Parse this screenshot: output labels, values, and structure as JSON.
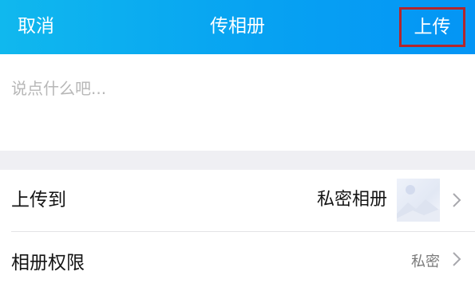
{
  "header": {
    "cancel_label": "取消",
    "title": "传相册",
    "upload_label": "上传",
    "background_color": "#07a2f2",
    "highlight_border_color": "#b3262c"
  },
  "caption": {
    "placeholder": "说点什么吧...",
    "value": ""
  },
  "settings": {
    "upload_to": {
      "label": "上传到",
      "value": "私密相册",
      "thumbnail_icon": "album-thumbnail-icon",
      "chevron_icon": "chevron-right-icon"
    },
    "permission": {
      "label": "相册权限",
      "value": "私密",
      "chevron_icon": "chevron-right-icon"
    }
  }
}
